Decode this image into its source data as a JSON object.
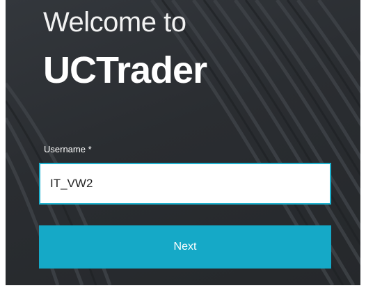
{
  "login": {
    "welcome_text": "Welcome to",
    "brand_name": "UCTrader",
    "username_label": "Username *",
    "username_value": "IT_VW2",
    "next_label": "Next"
  },
  "colors": {
    "panel_background": "#2b2e32",
    "accent": "#15a9c7",
    "input_border": "#1eb2cf",
    "text_light": "#ffffff"
  }
}
